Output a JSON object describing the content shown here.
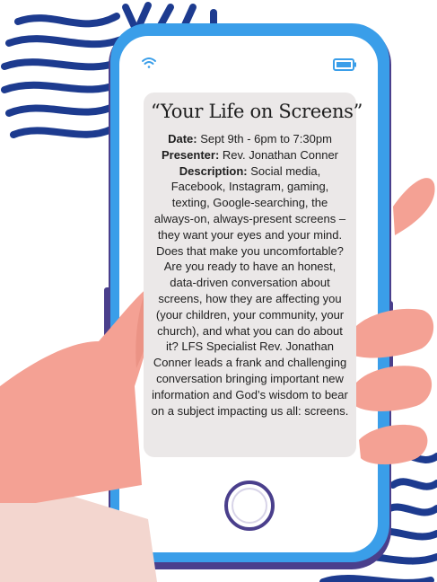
{
  "event": {
    "title": "“Your Life on Screens”",
    "date_label": "Date:",
    "date_value": " Sept 9th - 6pm to 7:30pm",
    "presenter_label": "Presenter:",
    "presenter_value": " Rev. Jonathan Conner",
    "description_label": "Description:",
    "description_value": " Social media, Facebook, Instagram, gaming, texting, Google-searching, the always-on, always-present screens – they want your eyes and your mind. Does that make you uncomfortable? Are you ready to have an honest, data-driven conversation about screens, how they are affecting you (your children, your community, your church), and what you can do about it? LFS Specialist Rev. Jonathan Conner leads a frank and challenging conversation bringing important new information and God’s wisdom to bear on a subject impacting us all: screens."
  },
  "status_bar": {
    "wifi_icon": "wifi-icon",
    "battery_icon": "battery-icon"
  },
  "home_button": {
    "icon": "home-button-icon"
  },
  "colors": {
    "phone_frame": "#3a9ee9",
    "phone_edge": "#4a3f8c",
    "screen": "#ffffff",
    "card": "#ebe8e8",
    "hand": "#f4a194",
    "hand_shadow": "#e58a7c",
    "sleeve": "#f3d6cf",
    "stripes": "#1d3b8f",
    "text": "#1e1e1e"
  }
}
